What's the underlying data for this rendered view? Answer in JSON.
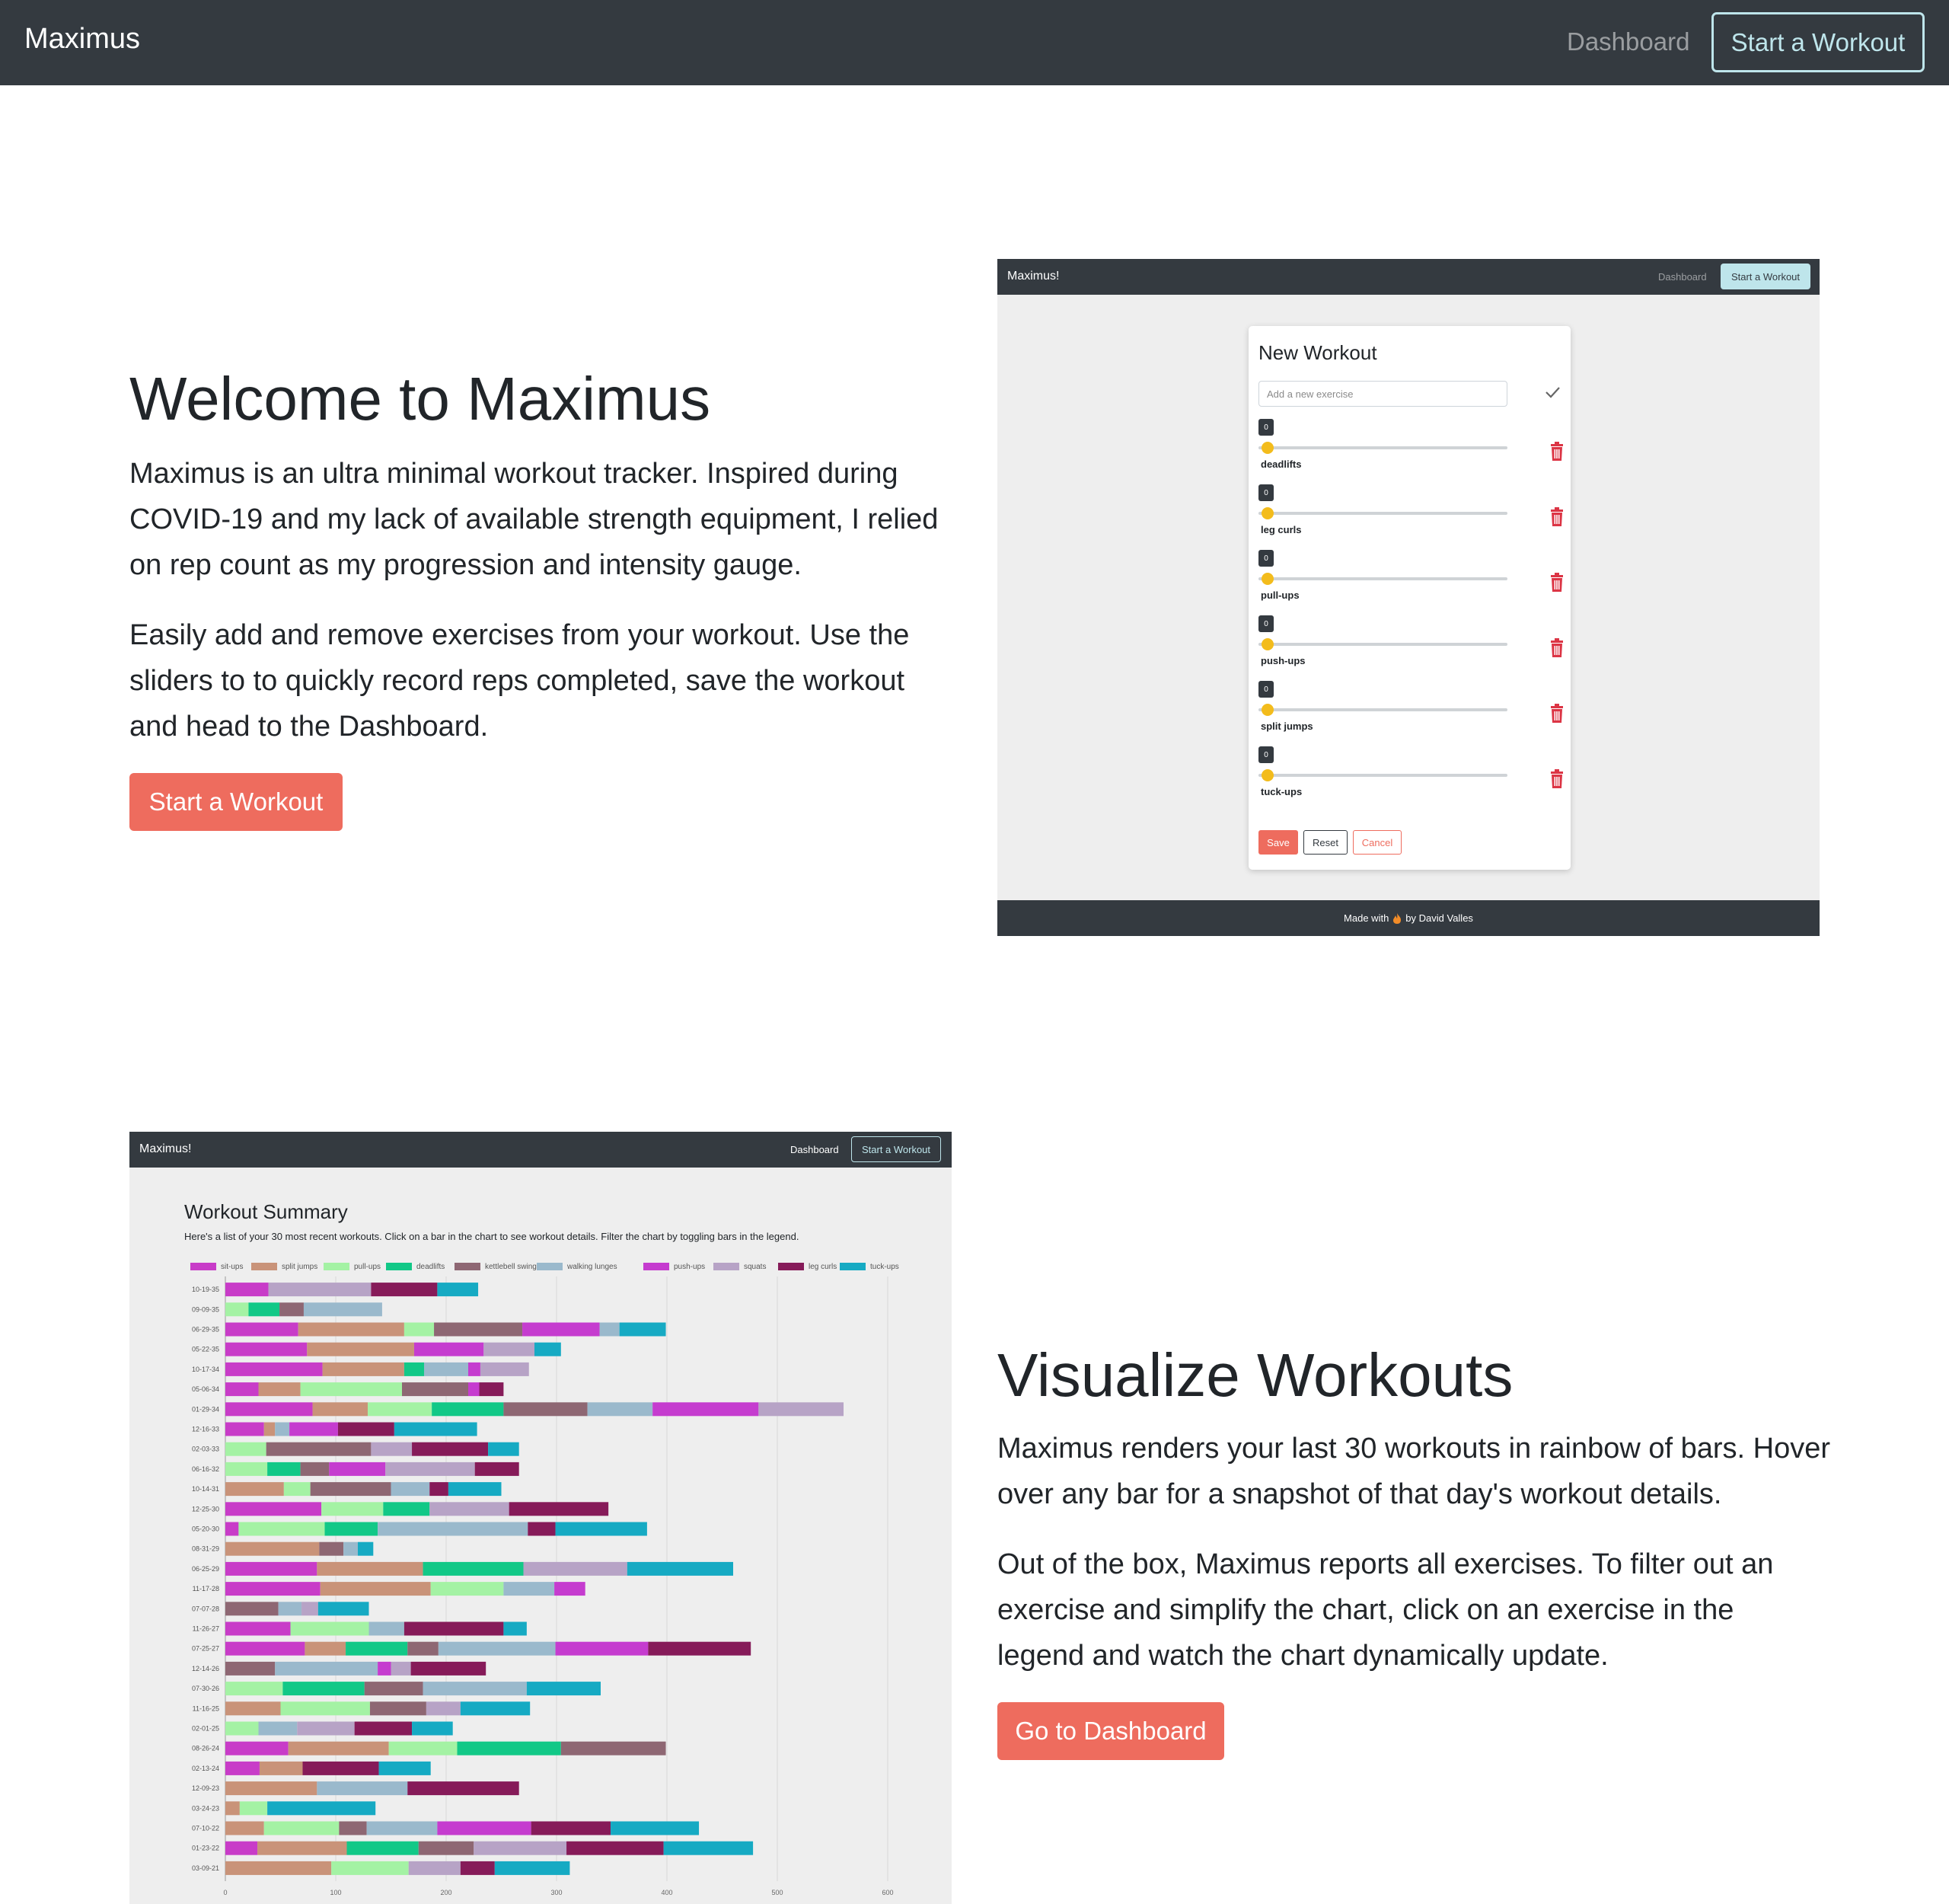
{
  "navbar": {
    "brand": "Maximus",
    "dashboard_link": "Dashboard",
    "start_button": "Start a Workout"
  },
  "section1": {
    "title": "Welcome to Maximus",
    "para1": "Maximus is an ultra minimal workout tracker. Inspired during COVID-19 and my lack of available strength equipment, I relied on rep count as my progression and intensity gauge.",
    "para2": "Easily add and remove exercises from your workout. Use the sliders to to quickly record reps completed, save the workout and head to the Dashboard.",
    "cta": "Start a Workout"
  },
  "shot1": {
    "brand": "Maximus!",
    "dashboard_link": "Dashboard",
    "start_button": "Start a Workout",
    "card_title": "New Workout",
    "input_placeholder": "Add a new exercise",
    "exercises": [
      {
        "name": "deadlifts",
        "reps": "0"
      },
      {
        "name": "leg curls",
        "reps": "0"
      },
      {
        "name": "pull-ups",
        "reps": "0"
      },
      {
        "name": "push-ups",
        "reps": "0"
      },
      {
        "name": "split jumps",
        "reps": "0"
      },
      {
        "name": "tuck-ups",
        "reps": "0"
      }
    ],
    "save": "Save",
    "reset": "Reset",
    "cancel": "Cancel",
    "footer_prefix": "Made with",
    "footer_suffix": "by David Valles"
  },
  "shot2": {
    "brand": "Maximus!",
    "dashboard_link": "Dashboard",
    "start_button": "Start a Workout",
    "title": "Workout Summary",
    "description": "Here's a list of your 30 most recent workouts. Click on a bar in the chart to see workout details. Filter the chart by toggling bars in the legend."
  },
  "section2": {
    "title": "Visualize Workouts",
    "para1": "Maximus renders your last 30 workouts in rainbow of bars. Hover over any bar for a snapshot of that day's workout details.",
    "para2": "Out of the box, Maximus reports all exercises. To filter out an exercise and simplify the chart, click on an exercise in the legend and watch the chart dynamically update.",
    "cta": "Go to Dashboard"
  },
  "colors": {
    "navbar": "#343a40",
    "accent": "#ee6c5e",
    "outline_button": "#bee5eb",
    "slider_thumb": "#f3bc1c",
    "trash": "#dc3545"
  },
  "chart_data": {
    "type": "bar",
    "orientation": "horizontal",
    "stacked": true,
    "xlim": [
      0,
      600
    ],
    "xticks": [
      0,
      100,
      200,
      300,
      400,
      500,
      600
    ],
    "grid": true,
    "legend_position": "top",
    "series_meta": [
      {
        "name": "sit-ups",
        "color": "#c83cc8"
      },
      {
        "name": "split jumps",
        "color": "#c99379"
      },
      {
        "name": "pull-ups",
        "color": "#a4f2a4"
      },
      {
        "name": "deadlifts",
        "color": "#12c887"
      },
      {
        "name": "kettlebell swings",
        "color": "#8e6773"
      },
      {
        "name": "walking lunges",
        "color": "#9ab9cc"
      },
      {
        "name": "push-ups",
        "color": "#c53ccf"
      },
      {
        "name": "squats",
        "color": "#b7a3c6"
      },
      {
        "name": "leg curls",
        "color": "#861b59"
      },
      {
        "name": "tuck-ups",
        "color": "#16aac3"
      }
    ],
    "categories": [
      "10-19-35",
      "09-09-35",
      "06-29-35",
      "05-22-35",
      "10-17-34",
      "05-06-34",
      "01-29-34",
      "12-16-33",
      "02-03-33",
      "06-16-32",
      "10-14-31",
      "12-25-30",
      "05-20-30",
      "08-31-29",
      "06-25-29",
      "11-17-28",
      "07-07-28",
      "11-26-27",
      "07-25-27",
      "12-14-26",
      "07-30-26",
      "11-16-25",
      "02-01-25",
      "08-26-24",
      "02-13-24",
      "12-09-23",
      "03-24-23",
      "07-10-22",
      "01-23-22",
      "03-09-21"
    ],
    "rows": [
      [
        [
          "sit-ups",
          39
        ],
        [
          "squats",
          93
        ],
        [
          "leg curls",
          60
        ],
        [
          "tuck-ups",
          37
        ]
      ],
      [
        [
          "pull-ups",
          21
        ],
        [
          "deadlifts",
          28
        ],
        [
          "kettlebell swings",
          22
        ],
        [
          "walking lunges",
          71
        ]
      ],
      [
        [
          "sit-ups",
          66
        ],
        [
          "split jumps",
          96
        ],
        [
          "pull-ups",
          27
        ],
        [
          "kettlebell swings",
          80
        ],
        [
          "push-ups",
          70
        ],
        [
          "walking lunges",
          18
        ],
        [
          "tuck-ups",
          42
        ]
      ],
      [
        [
          "sit-ups",
          74
        ],
        [
          "split jumps",
          97
        ],
        [
          "push-ups",
          63
        ],
        [
          "squats",
          46
        ],
        [
          "tuck-ups",
          24
        ]
      ],
      [
        [
          "sit-ups",
          88
        ],
        [
          "split jumps",
          74
        ],
        [
          "deadlifts",
          18
        ],
        [
          "walking lunges",
          40
        ],
        [
          "push-ups",
          11
        ],
        [
          "squats",
          44
        ]
      ],
      [
        [
          "sit-ups",
          30
        ],
        [
          "split jumps",
          38
        ],
        [
          "pull-ups",
          92
        ],
        [
          "kettlebell swings",
          60
        ],
        [
          "push-ups",
          10
        ],
        [
          "leg curls",
          22
        ]
      ],
      [
        [
          "sit-ups",
          79
        ],
        [
          "split jumps",
          50
        ],
        [
          "pull-ups",
          58
        ],
        [
          "deadlifts",
          65
        ],
        [
          "kettlebell swings",
          76
        ],
        [
          "walking lunges",
          59
        ],
        [
          "push-ups",
          96
        ],
        [
          "squats",
          77
        ]
      ],
      [
        [
          "sit-ups",
          35
        ],
        [
          "split jumps",
          10
        ],
        [
          "walking lunges",
          13
        ],
        [
          "push-ups",
          44
        ],
        [
          "leg curls",
          51
        ],
        [
          "tuck-ups",
          75
        ]
      ],
      [
        [
          "pull-ups",
          37
        ],
        [
          "kettlebell swings",
          95
        ],
        [
          "squats",
          37
        ],
        [
          "leg curls",
          69
        ],
        [
          "tuck-ups",
          28
        ]
      ],
      [
        [
          "pull-ups",
          38
        ],
        [
          "deadlifts",
          30
        ],
        [
          "kettlebell swings",
          26
        ],
        [
          "push-ups",
          51
        ],
        [
          "squats",
          81
        ],
        [
          "leg curls",
          40
        ]
      ],
      [
        [
          "split jumps",
          53
        ],
        [
          "pull-ups",
          24
        ],
        [
          "kettlebell swings",
          73
        ],
        [
          "walking lunges",
          35
        ],
        [
          "leg curls",
          17
        ],
        [
          "tuck-ups",
          48
        ]
      ],
      [
        [
          "sit-ups",
          87
        ],
        [
          "pull-ups",
          56
        ],
        [
          "deadlifts",
          42
        ],
        [
          "squats",
          72
        ],
        [
          "leg curls",
          90
        ]
      ],
      [
        [
          "sit-ups",
          12
        ],
        [
          "pull-ups",
          78
        ],
        [
          "deadlifts",
          48
        ],
        [
          "walking lunges",
          136
        ],
        [
          "leg curls",
          25
        ],
        [
          "tuck-ups",
          83
        ]
      ],
      [
        [
          "split jumps",
          85
        ],
        [
          "kettlebell swings",
          22
        ],
        [
          "walking lunges",
          13
        ],
        [
          "tuck-ups",
          14
        ]
      ],
      [
        [
          "sit-ups",
          83
        ],
        [
          "split jumps",
          96
        ],
        [
          "deadlifts",
          91
        ],
        [
          "squats",
          94
        ],
        [
          "tuck-ups",
          96
        ]
      ],
      [
        [
          "sit-ups",
          86
        ],
        [
          "split jumps",
          100
        ],
        [
          "pull-ups",
          66
        ],
        [
          "walking lunges",
          46
        ],
        [
          "push-ups",
          28
        ]
      ],
      [
        [
          "kettlebell swings",
          48
        ],
        [
          "walking lunges",
          21
        ],
        [
          "squats",
          15
        ],
        [
          "tuck-ups",
          46
        ]
      ],
      [
        [
          "sit-ups",
          59
        ],
        [
          "pull-ups",
          71
        ],
        [
          "walking lunges",
          32
        ],
        [
          "leg curls",
          90
        ],
        [
          "tuck-ups",
          21
        ]
      ],
      [
        [
          "sit-ups",
          72
        ],
        [
          "split jumps",
          37
        ],
        [
          "deadlifts",
          56
        ],
        [
          "kettlebell swings",
          28
        ],
        [
          "walking lunges",
          106
        ],
        [
          "push-ups",
          84
        ],
        [
          "leg curls",
          93
        ]
      ],
      [
        [
          "kettlebell swings",
          45
        ],
        [
          "walking lunges",
          93
        ],
        [
          "push-ups",
          12
        ],
        [
          "squats",
          18
        ],
        [
          "leg curls",
          68
        ]
      ],
      [
        [
          "pull-ups",
          52
        ],
        [
          "deadlifts",
          74
        ],
        [
          "kettlebell swings",
          53
        ],
        [
          "walking lunges",
          94
        ],
        [
          "tuck-ups",
          67
        ]
      ],
      [
        [
          "split jumps",
          50
        ],
        [
          "pull-ups",
          81
        ],
        [
          "kettlebell swings",
          51
        ],
        [
          "squats",
          31
        ],
        [
          "tuck-ups",
          63
        ]
      ],
      [
        [
          "pull-ups",
          30
        ],
        [
          "walking lunges",
          35
        ],
        [
          "squats",
          52
        ],
        [
          "leg curls",
          52
        ],
        [
          "tuck-ups",
          37
        ]
      ],
      [
        [
          "sit-ups",
          57
        ],
        [
          "split jumps",
          91
        ],
        [
          "pull-ups",
          62
        ],
        [
          "deadlifts",
          94
        ],
        [
          "kettlebell swings",
          95
        ]
      ],
      [
        [
          "sit-ups",
          31
        ],
        [
          "split jumps",
          39
        ],
        [
          "leg curls",
          69
        ],
        [
          "tuck-ups",
          47
        ]
      ],
      [
        [
          "split jumps",
          83
        ],
        [
          "walking lunges",
          82
        ],
        [
          "leg curls",
          101
        ]
      ],
      [
        [
          "split jumps",
          13
        ],
        [
          "pull-ups",
          25
        ],
        [
          "tuck-ups",
          98
        ]
      ],
      [
        [
          "split jumps",
          35
        ],
        [
          "pull-ups",
          68
        ],
        [
          "kettlebell swings",
          25
        ],
        [
          "walking lunges",
          64
        ],
        [
          "push-ups",
          85
        ],
        [
          "leg curls",
          72
        ],
        [
          "tuck-ups",
          80
        ]
      ],
      [
        [
          "sit-ups",
          29
        ],
        [
          "split jumps",
          81
        ],
        [
          "deadlifts",
          65
        ],
        [
          "kettlebell swings",
          50
        ],
        [
          "squats",
          84
        ],
        [
          "leg curls",
          88
        ],
        [
          "tuck-ups",
          81
        ]
      ],
      [
        [
          "split jumps",
          96
        ],
        [
          "pull-ups",
          70
        ],
        [
          "squats",
          47
        ],
        [
          "leg curls",
          31
        ],
        [
          "tuck-ups",
          68
        ]
      ]
    ]
  }
}
